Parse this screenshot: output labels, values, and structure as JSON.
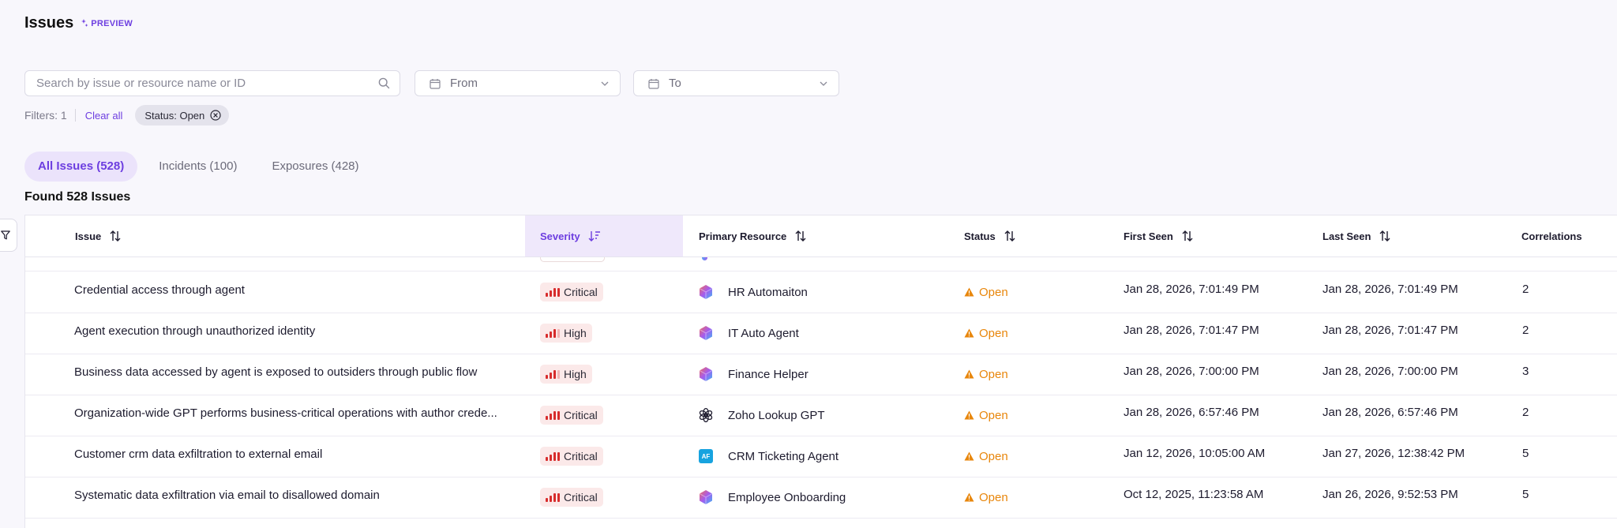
{
  "page": {
    "title": "Issues",
    "preview_label": "PREVIEW"
  },
  "search": {
    "placeholder": "Search by issue or resource name or ID"
  },
  "date_from": {
    "label": "From"
  },
  "date_to": {
    "label": "To"
  },
  "filters": {
    "count_label": "Filters: 1",
    "clear_all": "Clear all",
    "chip_label": "Status: Open"
  },
  "tabs": [
    {
      "label": "All Issues (528)",
      "active": true
    },
    {
      "label": "Incidents (100)",
      "active": false
    },
    {
      "label": "Exposures (428)",
      "active": false
    }
  ],
  "found_label": "Found 528 Issues",
  "columns": {
    "issue": "Issue",
    "severity": "Severity",
    "primary_resource": "Primary Resource",
    "status": "Status",
    "first_seen": "First Seen",
    "last_seen": "Last Seen",
    "correlations": "Correlations"
  },
  "rows": [
    {
      "issue": "Credential access through agent",
      "severity": "Critical",
      "resource": "HR Automaiton",
      "resource_icon": "hexagon-gradient-icon",
      "status": "Open",
      "first_seen": "Jan 28, 2026, 7:01:49 PM",
      "last_seen": "Jan 28, 2026, 7:01:49 PM",
      "correlations": "2"
    },
    {
      "issue": "Agent execution through unauthorized identity",
      "severity": "High",
      "resource": "IT Auto Agent",
      "resource_icon": "hexagon-gradient-icon",
      "status": "Open",
      "first_seen": "Jan 28, 2026, 7:01:47 PM",
      "last_seen": "Jan 28, 2026, 7:01:47 PM",
      "correlations": "2"
    },
    {
      "issue": "Business data accessed by agent is exposed to outsiders through public flow",
      "severity": "High",
      "resource": "Finance Helper",
      "resource_icon": "hexagon-gradient-icon",
      "status": "Open",
      "first_seen": "Jan 28, 2026, 7:00:00 PM",
      "last_seen": "Jan 28, 2026, 7:00:00 PM",
      "correlations": "3"
    },
    {
      "issue": "Organization-wide GPT performs business-critical operations with author crede...",
      "severity": "Critical",
      "resource": "Zoho Lookup GPT",
      "resource_icon": "openai-icon",
      "status": "Open",
      "first_seen": "Jan 28, 2026, 6:57:46 PM",
      "last_seen": "Jan 28, 2026, 6:57:46 PM",
      "correlations": "2"
    },
    {
      "issue": "Customer crm data exfiltration to external email",
      "severity": "Critical",
      "resource": "CRM Ticketing Agent",
      "resource_icon": "af-icon",
      "resource_icon_text": "AF",
      "status": "Open",
      "first_seen": "Jan 12, 2026, 10:05:00 AM",
      "last_seen": "Jan 27, 2026, 12:38:42 PM",
      "correlations": "5"
    },
    {
      "issue": "Systematic data exfiltration via email to disallowed domain",
      "severity": "Critical",
      "resource": "Employee Onboarding",
      "resource_icon": "hexagon-gradient-icon",
      "status": "Open",
      "first_seen": "Oct 12, 2025, 11:23:58 AM",
      "last_seen": "Jan 26, 2026, 9:52:53 PM",
      "correlations": "5"
    }
  ],
  "colors": {
    "accent": "#6d3ee0",
    "critical": "#d72c2c",
    "open_status": "#e8860b"
  }
}
